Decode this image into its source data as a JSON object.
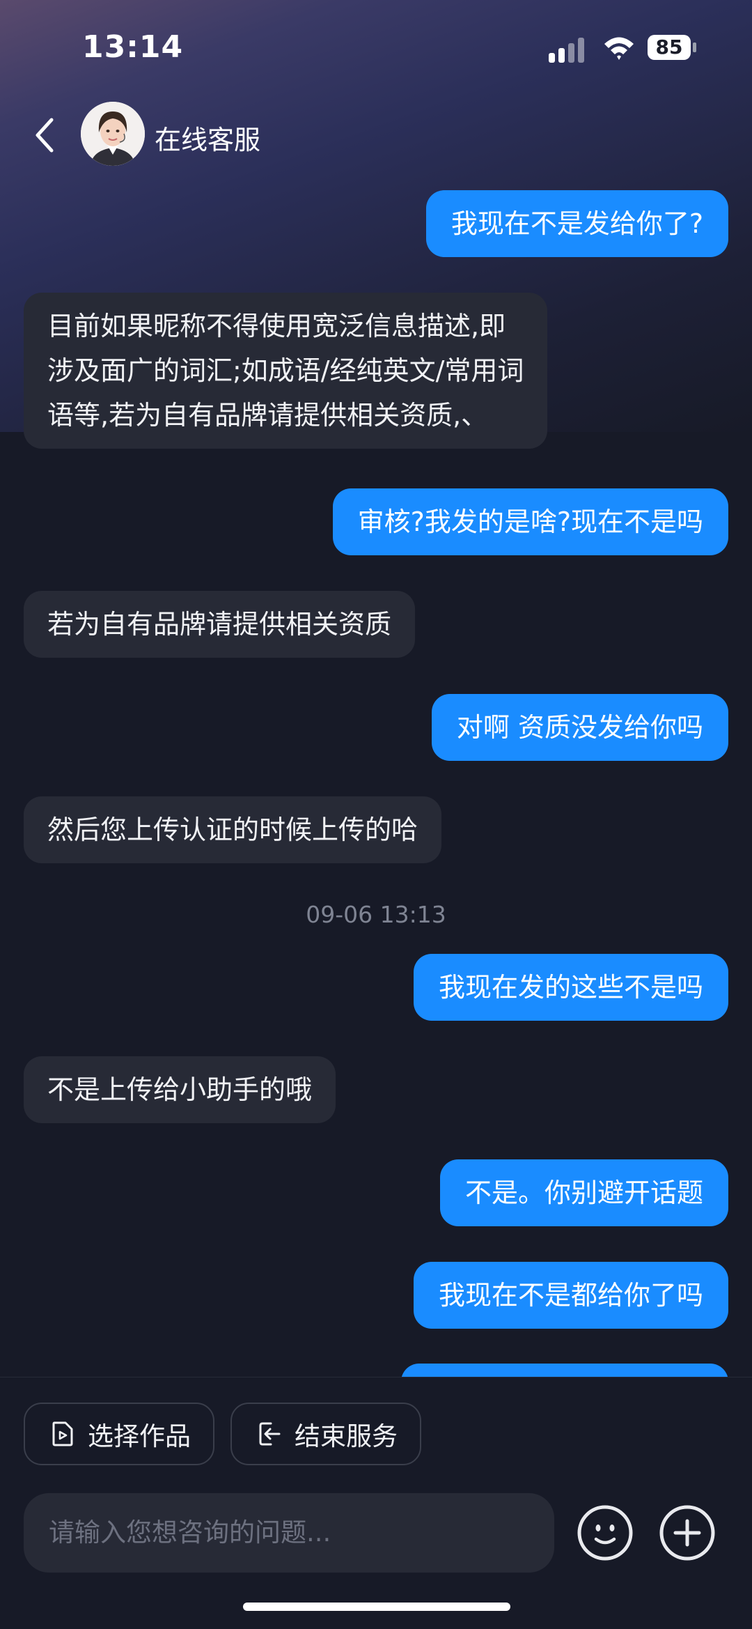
{
  "status_bar": {
    "time": "13:14",
    "battery": "85"
  },
  "header": {
    "title": "在线客服"
  },
  "messages": [
    {
      "side": "out",
      "text": "我现在不是发给你了?"
    },
    {
      "side": "in",
      "lines": [
        "目前如果昵称不得使用宽泛信息描述,即",
        "涉及面广的词汇;如成语/经纯英文/常用词",
        "语等,若为自有品牌请提供相关资质,、"
      ]
    },
    {
      "side": "out",
      "text": "审核?我发的是啥?现在不是吗"
    },
    {
      "side": "in",
      "text": "若为自有品牌请提供相关资质"
    },
    {
      "side": "out",
      "text": "对啊 资质没发给你吗"
    },
    {
      "side": "in",
      "text": "然后您上传认证的时候上传的哈"
    },
    {
      "side": "out",
      "text": "我现在发的这些不是吗"
    },
    {
      "side": "in",
      "text": "不是上传给小助手的哦"
    },
    {
      "side": "out",
      "text": "不是。你别避开话题"
    },
    {
      "side": "out",
      "text": "我现在不是都给你了吗"
    }
  ],
  "timestamp": "09-06 13:13",
  "actions": {
    "select_work": "选择作品",
    "end_service": "结束服务"
  },
  "input": {
    "placeholder": "请输入您想咨询的问题..."
  },
  "colors": {
    "outgoing_bubble": "#1a8cff",
    "incoming_bubble": "#272a36",
    "background": "#171a27"
  }
}
